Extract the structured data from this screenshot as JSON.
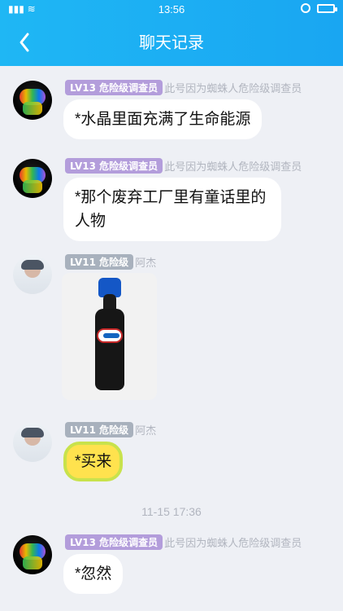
{
  "status_bar": {
    "time": "13:56"
  },
  "header": {
    "title": "聊天记录"
  },
  "messages": [
    {
      "level": "LV13",
      "title": "危险级调查员",
      "nickname": "此号因为蜘蛛人危险级调查员",
      "text": "*水晶里面充满了生命能源"
    },
    {
      "level": "LV13",
      "title": "危险级调查员",
      "nickname": "此号因为蜘蛛人危险级调查员",
      "text": "*那个废弃工厂里有童话里的人物"
    },
    {
      "level": "LV11",
      "title": "危险级",
      "nickname": "阿杰",
      "image_label": "bottle-photo"
    },
    {
      "level": "LV11",
      "title": "危险级",
      "nickname": "阿杰",
      "text": "*买来"
    }
  ],
  "timestamp": "11-15 17:36",
  "last_message": {
    "level": "LV13",
    "title": "危险级调查员",
    "nickname": "此号因为蜘蛛人危险级调查员",
    "text": "*忽然"
  },
  "colors": {
    "header_start": "#1fb7f4",
    "header_end": "#19a6f2",
    "level_purple": "#b39ddb",
    "level_gray": "#a8b1bd",
    "lemon_bubble": "#ffe24e"
  },
  "icons": {
    "back": "chevron-left-icon",
    "alarm": "alarm-icon",
    "battery": "battery-icon",
    "signal": "signal-icon",
    "wifi": "wifi-icon"
  }
}
